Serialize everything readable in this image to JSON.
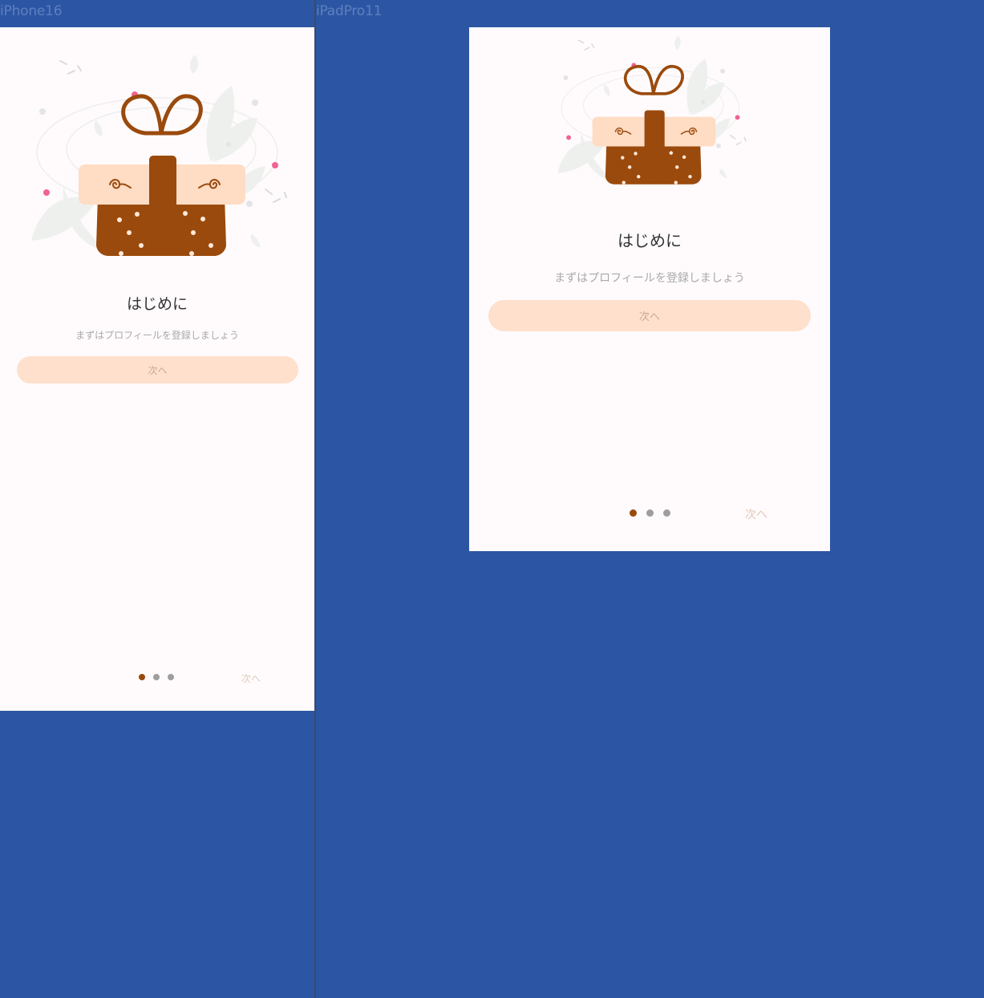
{
  "frames": {
    "left": {
      "label": "iPhone16"
    },
    "right": {
      "label": "iPadPro11"
    }
  },
  "screen": {
    "title": "はじめに",
    "subtitle": "まずはプロフィールを登録しましょう",
    "primary_button": "次へ",
    "footer_next": "次へ",
    "pagination": {
      "total": 3,
      "active_index": 0
    }
  },
  "colors": {
    "background": "#2c56a3",
    "screen": "#fffbfd",
    "button": "#ffe0cc",
    "gift_box": "#9a4a0c",
    "gift_lid": "#ffdcc4",
    "dot_active": "#9a4a0c",
    "dot_inactive": "#9e9e9e"
  },
  "illustration": {
    "icon": "gift-box-icon"
  }
}
